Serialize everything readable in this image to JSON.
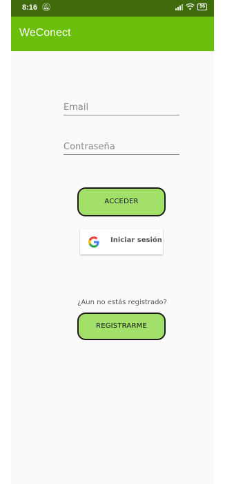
{
  "status_bar": {
    "time": "8:16",
    "battery": "96"
  },
  "app_bar": {
    "title": "WeConect"
  },
  "login": {
    "email_placeholder": "Email",
    "password_placeholder": "Contraseña",
    "submit_label": "ACCEDER",
    "google_label": "Iniciar sesión"
  },
  "register": {
    "prompt": "¿Aun no estás registrado?",
    "button_label": "REGISTRARME"
  },
  "colors": {
    "status_bar": "#3f6b0d",
    "app_bar": "#6abf0a",
    "button_fill": "#a3e06a"
  }
}
